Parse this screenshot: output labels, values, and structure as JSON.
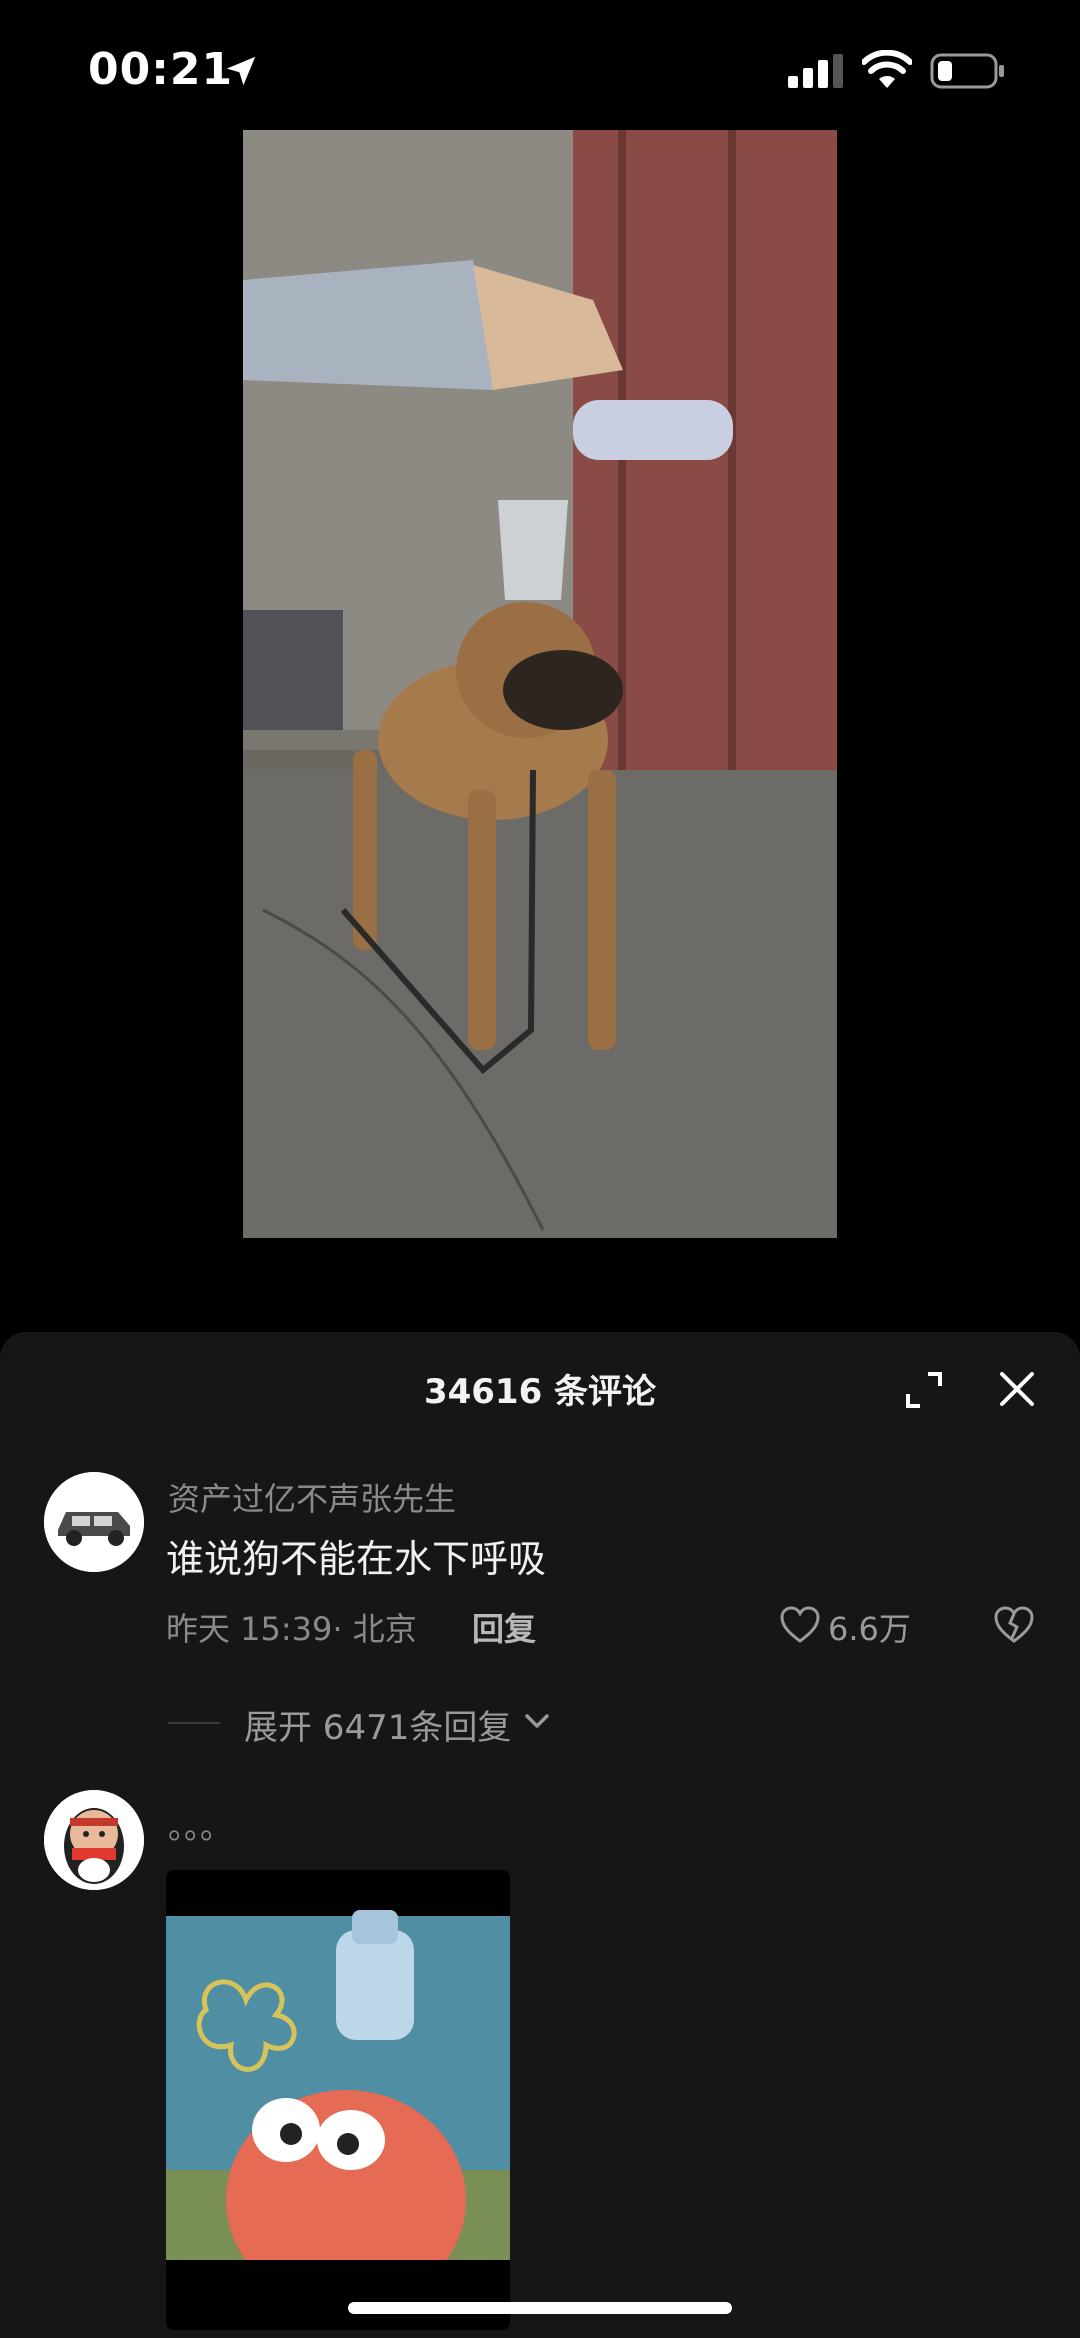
{
  "status_bar": {
    "time": "00:21"
  },
  "comments_panel": {
    "title": "34616 条评论",
    "comments": [
      {
        "username": "资产过亿不声张先生",
        "text": "谁说狗不能在水下呼吸",
        "meta": "昨天 15:39· 北京",
        "reply_label": "回复",
        "likes": "6.6万",
        "expand_replies": "展开 6471条回复"
      },
      {
        "username": "。。。"
      }
    ]
  },
  "colors": {
    "panel_bg": "#161616",
    "muted_text": "#8a8a8a"
  }
}
